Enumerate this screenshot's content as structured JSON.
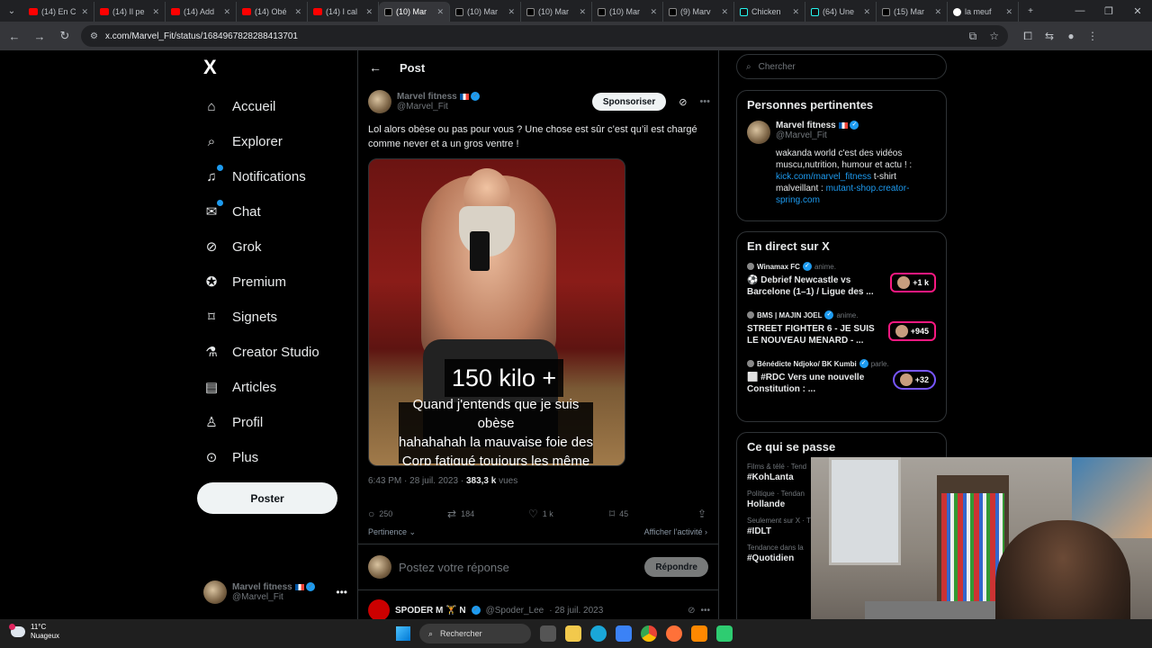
{
  "browser": {
    "tabs": [
      {
        "title": "(14) En C",
        "icon": "youtube"
      },
      {
        "title": "(14) Il pe",
        "icon": "youtube"
      },
      {
        "title": "(14) Add",
        "icon": "youtube"
      },
      {
        "title": "(14) Obé",
        "icon": "youtube"
      },
      {
        "title": "(14) I cal",
        "icon": "youtube"
      },
      {
        "title": "(10) Mar",
        "icon": "x",
        "active": true
      },
      {
        "title": "(10) Mar",
        "icon": "x"
      },
      {
        "title": "(10) Mar",
        "icon": "x"
      },
      {
        "title": "(10) Mar",
        "icon": "x"
      },
      {
        "title": "(9) Marv",
        "icon": "x"
      },
      {
        "title": "Chicken",
        "icon": "tiktok"
      },
      {
        "title": "(64) Une",
        "icon": "tiktok"
      },
      {
        "title": "(15) Mar",
        "icon": "x"
      },
      {
        "title": "la meuf",
        "icon": "google"
      }
    ],
    "url": "x.com/Marvel_Fit/status/1684967828288413701"
  },
  "nav": {
    "logo": "X",
    "items": [
      {
        "label": "Accueil",
        "icon": "home-icon"
      },
      {
        "label": "Explorer",
        "icon": "search-icon"
      },
      {
        "label": "Notifications",
        "icon": "bell-icon"
      },
      {
        "label": "Chat",
        "icon": "mail-icon"
      },
      {
        "label": "Grok",
        "icon": "grok-icon"
      },
      {
        "label": "Premium",
        "icon": "premium-icon"
      },
      {
        "label": "Signets",
        "icon": "bookmark-icon"
      },
      {
        "label": "Creator Studio",
        "icon": "flask-icon"
      },
      {
        "label": "Articles",
        "icon": "article-icon"
      },
      {
        "label": "Profil",
        "icon": "profile-icon"
      },
      {
        "label": "Plus",
        "icon": "more-icon"
      }
    ],
    "post_button": "Poster",
    "account": {
      "name": "Marvel fitness",
      "handle": "@Marvel_Fit"
    }
  },
  "main": {
    "header_title": "Post",
    "tweet": {
      "author": "Marvel fitness",
      "handle": "@Marvel_Fit",
      "sponsor_label": "Sponsoriser",
      "text": "Lol alors obèse ou pas pour vous ? Une chose est sûr c’est qu’il est chargé comme never et a un gros ventre !",
      "media_caption_1": "150 kilo +",
      "media_caption_2": [
        "Quand j'entends que je suis obèse",
        "hahahahah la mauvaise foie des",
        "Corp fatigué toujours les même"
      ],
      "time": "6:43 PM · 28 juil. 2023 · ",
      "views_count": "383,3 k",
      "views_label": " vues",
      "replies": "250",
      "reposts": "184",
      "likes": "1 k",
      "bookmarks": "45",
      "sort_label": "Pertinence",
      "activity_label": "Afficher l’activité"
    },
    "reply_placeholder": "Postez votre réponse",
    "reply_button": "Répondre",
    "next_tweet": {
      "author": "SPODER M 🏋️ N",
      "handle": "@Spoder_Lee",
      "date": "· 28 juil. 2023"
    }
  },
  "sidebar": {
    "search_placeholder": "Chercher",
    "relevant": {
      "title": "Personnes pertinentes",
      "name": "Marvel fitness",
      "handle": "@Marvel_Fit",
      "bio_1": "wakanda world c'est des vidéos muscu,nutrition, humour et actu ! : ",
      "bio_link_1": "kick.com/marvel_fitness",
      "bio_2": " t-shirt malveillant : ",
      "bio_link_2": "mutant-shop.creator-spring.com"
    },
    "live": {
      "title": "En direct sur X",
      "items": [
        {
          "host": "Winamax FC",
          "status": "anime.",
          "desc": "⚽ Debrief Newcastle vs Barcelone (1–1) / Ligue des ...",
          "count": "+1 k",
          "pill_style": "pink"
        },
        {
          "host": "BMS | MAJIN JOEL",
          "status": "anime.",
          "desc": "STREET FIGHTER 6 - JE SUIS LE NOUVEAU MENARD - ...",
          "count": "+945",
          "pill_style": "pink"
        },
        {
          "host": "Bénédicte Ndjoko/ BK Kumbi",
          "status": "parle.",
          "desc": "⬜ #RDC Vers une nouvelle Constitution : ...",
          "count": "+32",
          "pill_style": "purple"
        }
      ]
    },
    "trends": {
      "title": "Ce qui se passe",
      "items": [
        {
          "category": "Films & télé · Tend",
          "tag": "#KohLanta"
        },
        {
          "category": "Politique · Tendan",
          "tag": "Hollande"
        },
        {
          "category": "Seulement sur X · T",
          "tag": "#IDLT"
        },
        {
          "category": "Tendance dans la",
          "tag": "#Quotidien"
        }
      ]
    }
  },
  "taskbar": {
    "temp": "11°C",
    "weather": "Nuageux",
    "search": "Rechercher"
  }
}
